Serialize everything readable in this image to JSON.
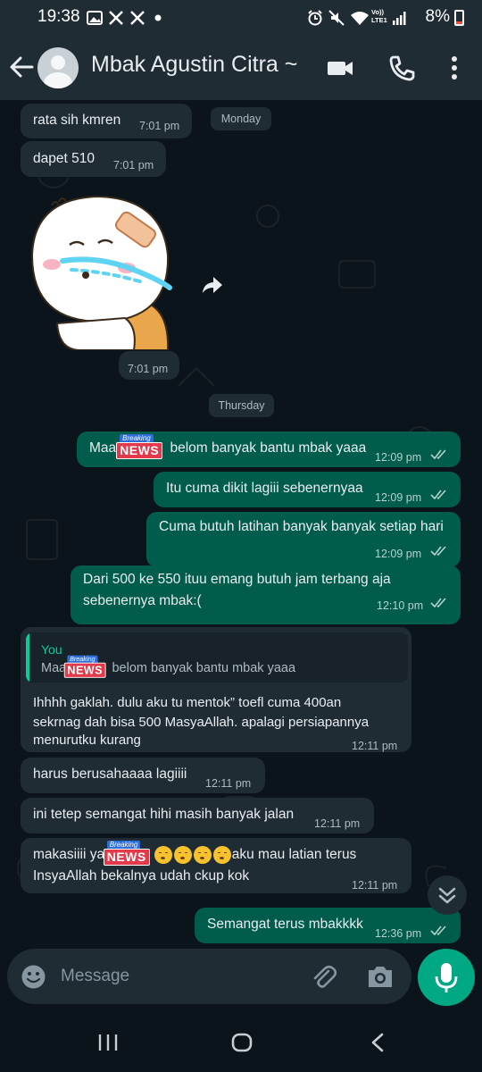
{
  "status_bar": {
    "time": "19:38",
    "battery_text": "8%",
    "left_icons": [
      "gallery-icon",
      "x-icon",
      "x-icon",
      "dot-icon"
    ],
    "right_icons": [
      "alarm-icon",
      "mute-icon",
      "wifi-icon",
      "volte-icon",
      "signal-icon",
      "battery-icon"
    ],
    "volte_label": "Vo)) LTE1"
  },
  "header": {
    "contact_name": "Mbak Agustin Citra ~",
    "icons": [
      "back-arrow-icon",
      "avatar",
      "video-call-icon",
      "voice-call-icon",
      "more-options-icon"
    ]
  },
  "dates": {
    "monday": "Monday",
    "thursday": "Thursday"
  },
  "messages": [
    {
      "dir": "in",
      "text": "rata sih kmren",
      "time": "7:01 pm"
    },
    {
      "dir": "in",
      "text": "dapet 510",
      "time": "7:01 pm"
    },
    {
      "dir": "in",
      "type": "sticker",
      "time": "7:01 pm"
    },
    {
      "dir": "out",
      "text_before": "Maa",
      "text_after": "belom banyak bantu mbak yaaa",
      "time": "12:09 pm"
    },
    {
      "dir": "out",
      "text": "Itu cuma dikit lagiii sebenernyaa",
      "time": "12:09 pm"
    },
    {
      "dir": "out",
      "text": "Cuma butuh latihan banyak banyak setiap hari",
      "time": "12:09 pm"
    },
    {
      "dir": "out",
      "line1": "Dari 500 ke 550 ituu emang butuh jam terbang aja",
      "line2": "sebenernya mbak:(",
      "time": "12:10 pm"
    },
    {
      "dir": "in",
      "quote_author": "You",
      "quote_before": "Maafi",
      "quote_after": "belom banyak bantu mbak yaaa",
      "line1": "Ihhhh gaklah. dulu aku tu mentok” toefl cuma 400an",
      "line2": "sekrnag dah bisa 500 MasyaAllah. apalagi persiapannya",
      "line3": "menurutku kurang",
      "time": "12:11 pm"
    },
    {
      "dir": "in",
      "text": "harus berusahaaaa lagiiii",
      "time": "12:11 pm"
    },
    {
      "dir": "in",
      "text": "ini tetep semangat hihi masih banyak jalan",
      "time": "12:11 pm"
    },
    {
      "dir": "in",
      "line1_before": "makasiiii yaa",
      "line1_after": "aku mau latian terus",
      "line2": "InsyaAllah bekalnya udah ckup kok",
      "time": "12:11 pm"
    },
    {
      "dir": "out",
      "text": "Semangat terus mbakkkk",
      "time": "12:36 pm"
    }
  ],
  "news_badge": {
    "top": "Breaking",
    "main": "NEWS"
  },
  "input": {
    "placeholder": "Message"
  },
  "colors": {
    "header": "#1f2c34",
    "background": "#0b141a",
    "incoming": "#1f2c34",
    "outgoing": "#005c4b",
    "accent": "#00a884"
  }
}
